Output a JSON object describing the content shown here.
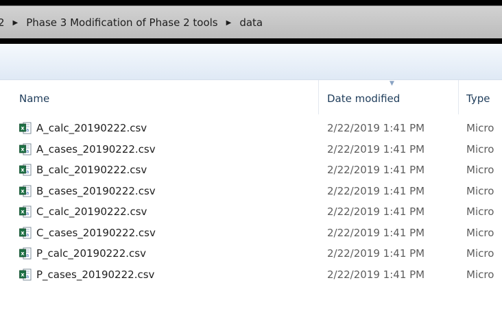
{
  "address": {
    "crumbs": [
      "2",
      "Phase 3 Modification of Phase 2 tools",
      "data"
    ]
  },
  "columns": {
    "name": "Name",
    "date": "Date modified",
    "type": "Type"
  },
  "files": [
    {
      "name": "A_calc_20190222.csv",
      "date": "2/22/2019 1:41 PM",
      "type": "Micro"
    },
    {
      "name": "A_cases_20190222.csv",
      "date": "2/22/2019 1:41 PM",
      "type": "Micro"
    },
    {
      "name": "B_calc_20190222.csv",
      "date": "2/22/2019 1:41 PM",
      "type": "Micro"
    },
    {
      "name": "B_cases_20190222.csv",
      "date": "2/22/2019 1:41 PM",
      "type": "Micro"
    },
    {
      "name": "C_calc_20190222.csv",
      "date": "2/22/2019 1:41 PM",
      "type": "Micro"
    },
    {
      "name": "C_cases_20190222.csv",
      "date": "2/22/2019 1:41 PM",
      "type": "Micro"
    },
    {
      "name": "P_calc_20190222.csv",
      "date": "2/22/2019 1:41 PM",
      "type": "Micro"
    },
    {
      "name": "P_cases_20190222.csv",
      "date": "2/22/2019 1:41 PM",
      "type": "Micro"
    }
  ],
  "icons": {
    "file": "excel-csv-icon",
    "separator": "breadcrumb-arrow-icon"
  },
  "colors": {
    "excel_green": "#1e7145",
    "header_text": "#1e3c5a"
  }
}
